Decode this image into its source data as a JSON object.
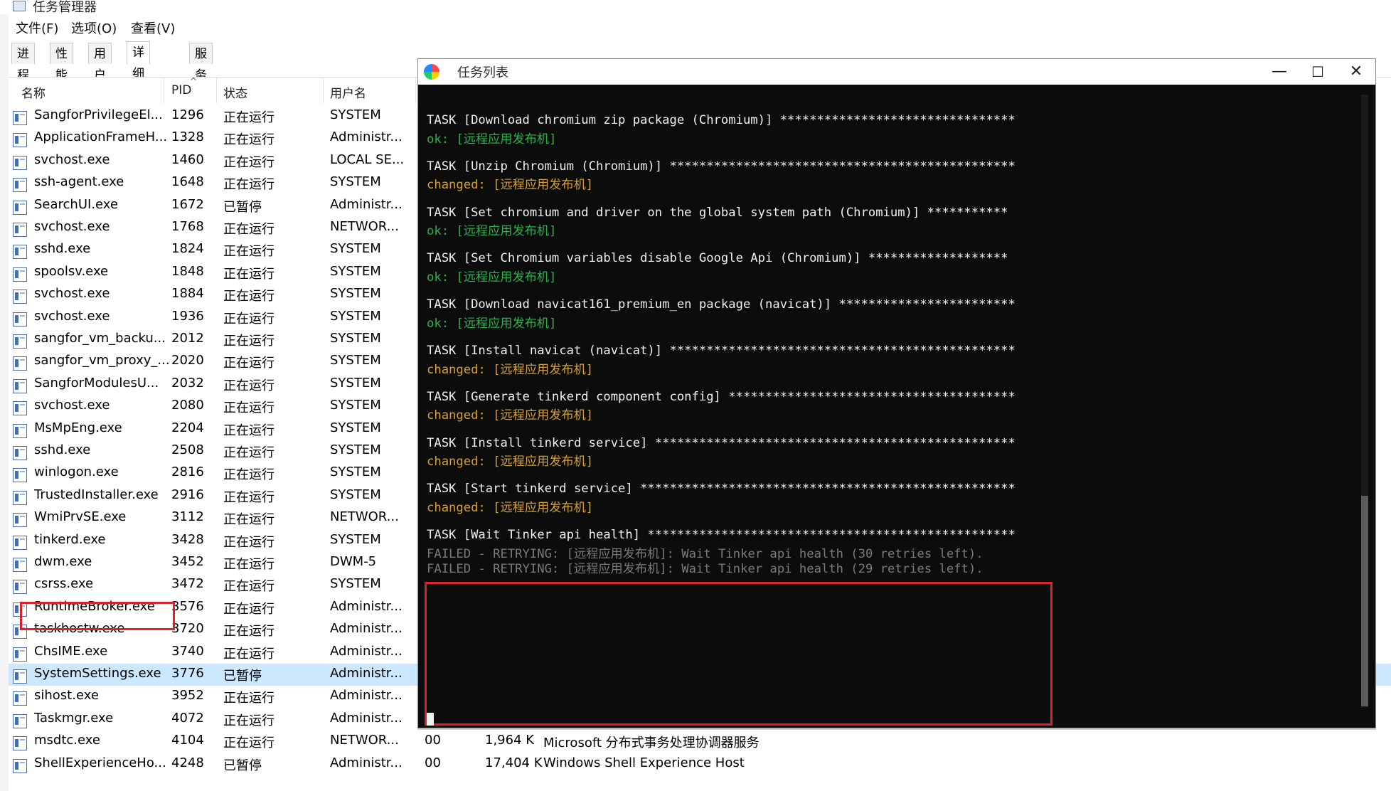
{
  "taskmanager": {
    "title": "任务管理器",
    "menu": [
      "文件(F)",
      "选项(O)",
      "查看(V)"
    ],
    "tabs": [
      "进程",
      "性能",
      "用户",
      "详细信息",
      "服务"
    ],
    "active_tab": "详细信息",
    "columns": {
      "name": "名称",
      "pid": "PID",
      "status": "状态",
      "user": "用户名"
    },
    "processes": [
      {
        "name": "SangforPrivilegeEl...",
        "pid": "1296",
        "status": "正在运行",
        "user": "SYSTEM"
      },
      {
        "name": "ApplicationFrameH...",
        "pid": "1328",
        "status": "正在运行",
        "user": "Administr..."
      },
      {
        "name": "svchost.exe",
        "pid": "1460",
        "status": "正在运行",
        "user": "LOCAL SE..."
      },
      {
        "name": "ssh-agent.exe",
        "pid": "1648",
        "status": "正在运行",
        "user": "SYSTEM"
      },
      {
        "name": "SearchUI.exe",
        "pid": "1672",
        "status": "已暂停",
        "user": "Administr..."
      },
      {
        "name": "svchost.exe",
        "pid": "1768",
        "status": "正在运行",
        "user": "NETWOR..."
      },
      {
        "name": "sshd.exe",
        "pid": "1824",
        "status": "正在运行",
        "user": "SYSTEM"
      },
      {
        "name": "spoolsv.exe",
        "pid": "1848",
        "status": "正在运行",
        "user": "SYSTEM"
      },
      {
        "name": "svchost.exe",
        "pid": "1884",
        "status": "正在运行",
        "user": "SYSTEM"
      },
      {
        "name": "svchost.exe",
        "pid": "1936",
        "status": "正在运行",
        "user": "SYSTEM"
      },
      {
        "name": "sangfor_vm_backu...",
        "pid": "2012",
        "status": "正在运行",
        "user": "SYSTEM"
      },
      {
        "name": "sangfor_vm_proxy_...",
        "pid": "2020",
        "status": "正在运行",
        "user": "SYSTEM"
      },
      {
        "name": "SangforModulesU...",
        "pid": "2032",
        "status": "正在运行",
        "user": "SYSTEM"
      },
      {
        "name": "svchost.exe",
        "pid": "2080",
        "status": "正在运行",
        "user": "SYSTEM"
      },
      {
        "name": "MsMpEng.exe",
        "pid": "2204",
        "status": "正在运行",
        "user": "SYSTEM"
      },
      {
        "name": "sshd.exe",
        "pid": "2508",
        "status": "正在运行",
        "user": "SYSTEM"
      },
      {
        "name": "winlogon.exe",
        "pid": "2816",
        "status": "正在运行",
        "user": "SYSTEM"
      },
      {
        "name": "TrustedInstaller.exe",
        "pid": "2916",
        "status": "正在运行",
        "user": "SYSTEM"
      },
      {
        "name": "WmiPrvSE.exe",
        "pid": "3112",
        "status": "正在运行",
        "user": "NETWOR..."
      },
      {
        "name": "tinkerd.exe",
        "pid": "3428",
        "status": "正在运行",
        "user": "SYSTEM"
      },
      {
        "name": "dwm.exe",
        "pid": "3452",
        "status": "正在运行",
        "user": "DWM-5"
      },
      {
        "name": "csrss.exe",
        "pid": "3472",
        "status": "正在运行",
        "user": "SYSTEM"
      },
      {
        "name": "RuntimeBroker.exe",
        "pid": "3576",
        "status": "正在运行",
        "user": "Administr..."
      },
      {
        "name": "taskhostw.exe",
        "pid": "3720",
        "status": "正在运行",
        "user": "Administr..."
      },
      {
        "name": "ChsIME.exe",
        "pid": "3740",
        "status": "正在运行",
        "user": "Administr..."
      },
      {
        "name": "SystemSettings.exe",
        "pid": "3776",
        "status": "已暂停",
        "user": "Administr..."
      },
      {
        "name": "sihost.exe",
        "pid": "3952",
        "status": "正在运行",
        "user": "Administr..."
      },
      {
        "name": "Taskmgr.exe",
        "pid": "4072",
        "status": "正在运行",
        "user": "Administr..."
      },
      {
        "name": "msdtc.exe",
        "pid": "4104",
        "status": "正在运行",
        "user": "NETWOR...",
        "cpu": "00",
        "mem": "1,964 K",
        "desc": "Microsoft 分布式事务处理协调器服务"
      },
      {
        "name": "ShellExperienceHo...",
        "pid": "4248",
        "status": "已暂停",
        "user": "Administr...",
        "cpu": "00",
        "mem": "17,404 K",
        "desc": "Windows Shell Experience Host"
      }
    ]
  },
  "console": {
    "title": "任务列表",
    "buttons": {
      "minimize": "—",
      "maximize": "☐",
      "close": "✕"
    },
    "lines": [
      {
        "text": "TASK [Download chromium zip package (Chromium)] ********************************",
        "style": "normal"
      },
      {
        "text": "ok: [远程应用发布机]",
        "style": "ok"
      },
      {
        "text": "TASK [Unzip Chromium (Chromium)] ***********************************************",
        "style": "normal"
      },
      {
        "text": "changed: [远程应用发布机]",
        "style": "changed"
      },
      {
        "text": "TASK [Set chromium and driver on the global system path (Chromium)] ***********",
        "style": "normal"
      },
      {
        "text": "ok: [远程应用发布机]",
        "style": "ok"
      },
      {
        "text": "TASK [Set Chromium variables disable Google Api (Chromium)] *******************",
        "style": "normal"
      },
      {
        "text": "ok: [远程应用发布机]",
        "style": "ok"
      },
      {
        "text": "TASK [Download navicat161_premium_en package (navicat)] ************************",
        "style": "normal"
      },
      {
        "text": "ok: [远程应用发布机]",
        "style": "ok"
      },
      {
        "text": "TASK [Install navicat (navicat)] ***********************************************",
        "style": "normal"
      },
      {
        "text": "changed: [远程应用发布机]",
        "style": "changed"
      },
      {
        "text": "TASK [Generate tinkerd component config] ***************************************",
        "style": "normal"
      },
      {
        "text": "changed: [远程应用发布机]",
        "style": "changed"
      },
      {
        "text": "TASK [Install tinkerd service] *************************************************",
        "style": "normal"
      },
      {
        "text": "changed: [远程应用发布机]",
        "style": "changed"
      },
      {
        "text": "TASK [Start tinkerd service] ***************************************************",
        "style": "normal"
      },
      {
        "text": "changed: [远程应用发布机]",
        "style": "changed"
      },
      {
        "text": "TASK [Wait Tinker api health] **************************************************",
        "style": "normal"
      },
      {
        "text": "FAILED - RETRYING: [远程应用发布机]: Wait Tinker api health (30 retries left).",
        "style": "failed"
      },
      {
        "text": "FAILED - RETRYING: [远程应用发布机]: Wait Tinker api health (29 retries left).",
        "style": "failed"
      }
    ]
  },
  "colors": {
    "ok": "#27b34a",
    "changed": "#d7a02a",
    "failed": "#7a7a7a",
    "highlight": "#d7232b",
    "selection": "#cce8ff"
  }
}
